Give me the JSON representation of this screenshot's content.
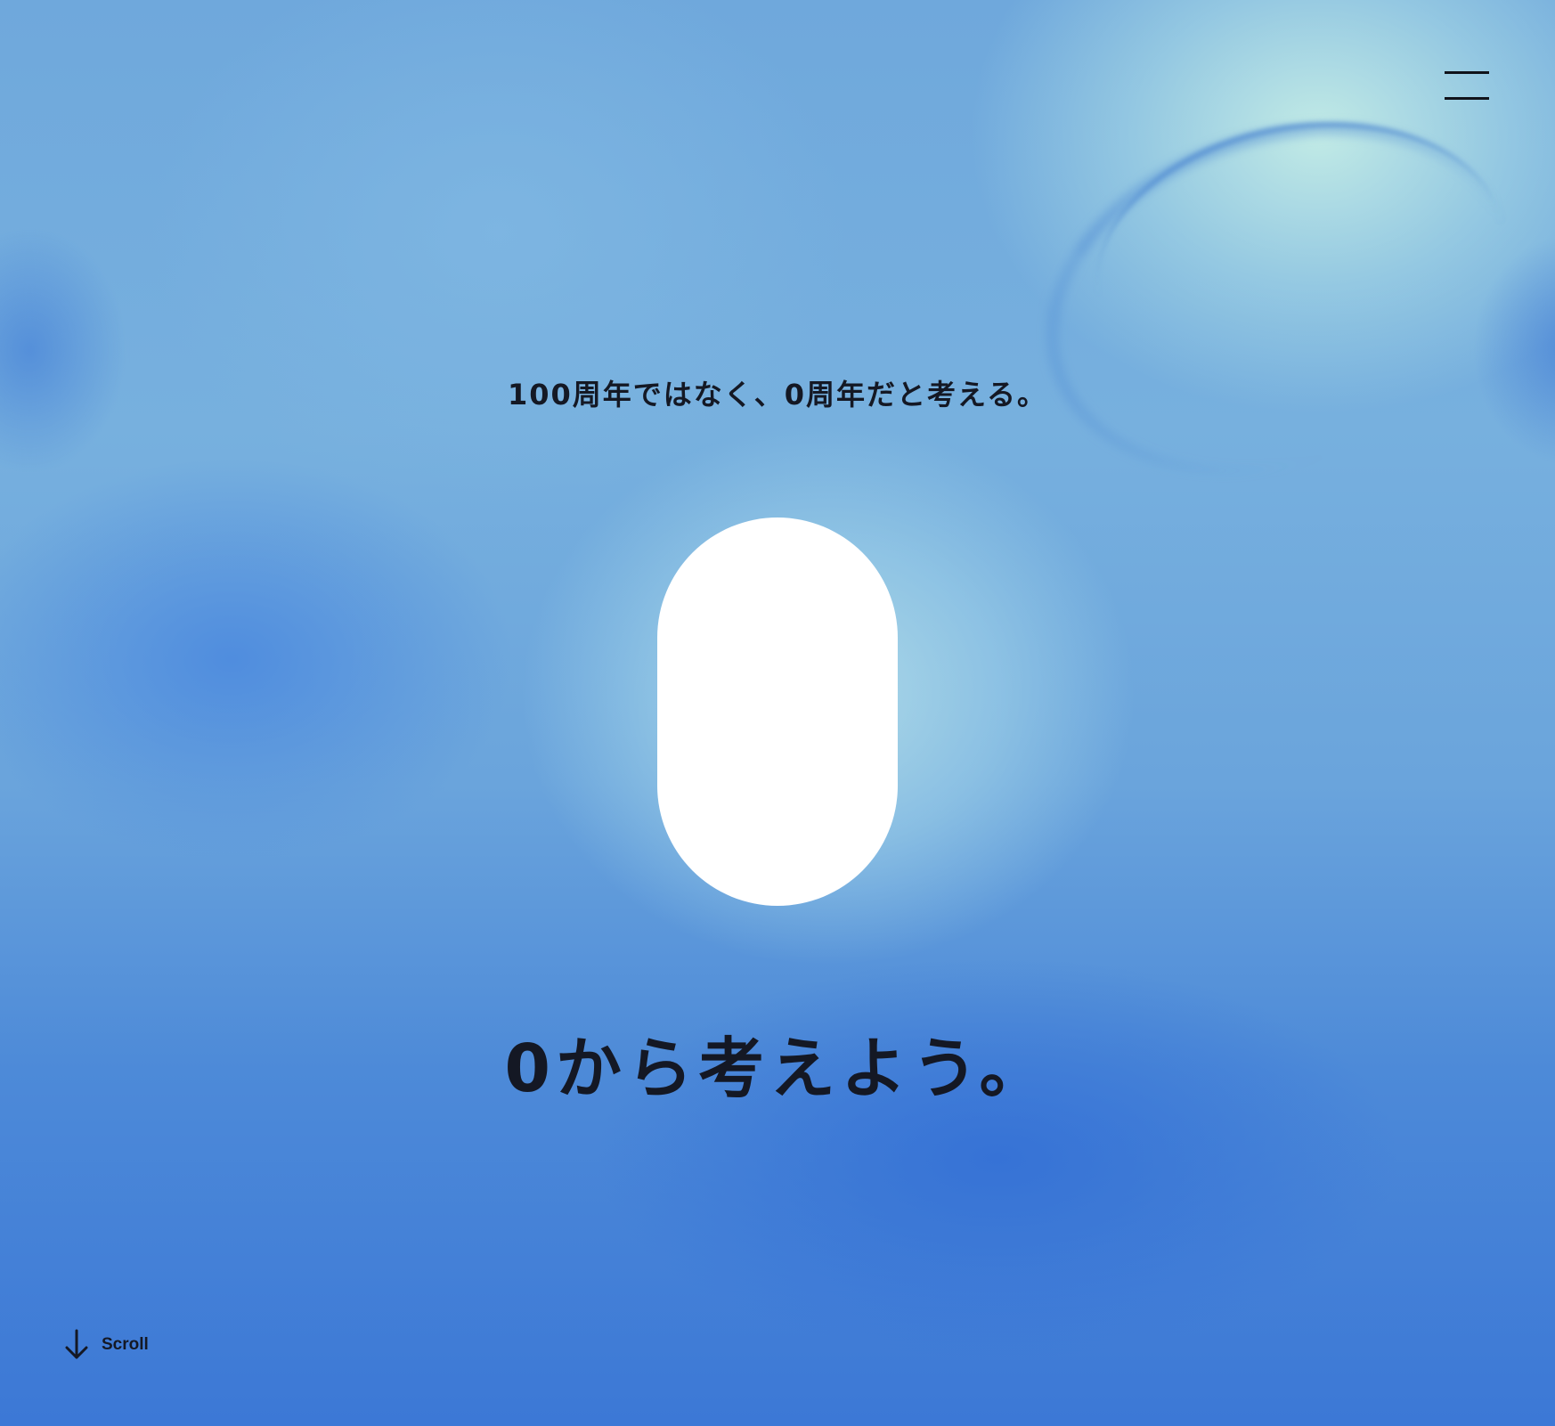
{
  "header": {
    "menu_icon": "hamburger-menu-icon"
  },
  "hero": {
    "tagline": "100周年ではなく、0周年だと考える。",
    "headline": "0から考えよう。",
    "accent_colors": {
      "background_blue": "#3f7fd8",
      "highlight_mint": "#c6eee6",
      "shape_white": "#ffffff",
      "text_dark": "#141824"
    }
  },
  "scroll": {
    "icon": "arrow-down-icon",
    "label": "Scroll"
  }
}
